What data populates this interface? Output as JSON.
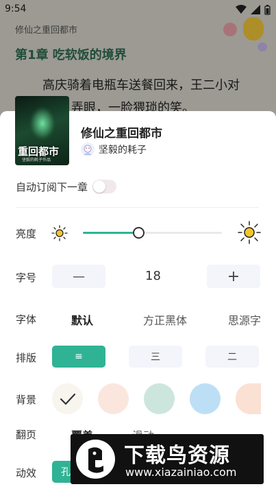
{
  "status_bar": {
    "time": "9:54"
  },
  "reader": {
    "book_name": "修仙之重回都市",
    "chapter_title": "第1章 吃软饭的境界",
    "paragraph_line1": "高庆骑着电瓶车送餐回来，王二小对",
    "paragraph_line2": "弄眼，一脸猥琐的笑。"
  },
  "book": {
    "title": "修仙之重回都市",
    "author": "坚毅的耗子",
    "cover_title": "重回都市",
    "cover_subtitle": "坚毅的耗子作品"
  },
  "settings": {
    "auto_subscribe": {
      "label": "自动订阅下一章",
      "enabled": false
    },
    "brightness": {
      "label": "亮度",
      "level": 0.4
    },
    "font_size": {
      "label": "字号",
      "value": "18",
      "decrease": "—",
      "increase": "+"
    },
    "font": {
      "label": "字体",
      "options": [
        "默认",
        "方正黑体",
        "思源字"
      ],
      "selected": "默认"
    },
    "layout": {
      "label": "排版",
      "options": [
        "≡",
        "三",
        "二"
      ],
      "selected_index": 0
    },
    "background": {
      "label": "背景",
      "check_icon": "check-icon",
      "colors": [
        "#f8f5ef",
        "#fbe6de",
        "#cce6de",
        "#bddff6",
        "#fbe1d3"
      ]
    },
    "page_turn": {
      "label": "翻页",
      "options": [
        "覆盖",
        "滑动"
      ],
      "selected": "覆盖"
    },
    "animation": {
      "label": "动效",
      "option": "孔"
    }
  },
  "watermark": {
    "text": "下载鸟资源",
    "url": "www.xiazainiao.com"
  },
  "colors": {
    "accent": "#2fb394",
    "chapter_title": "#2e6b52",
    "sun_icon": "#f3c72a"
  }
}
